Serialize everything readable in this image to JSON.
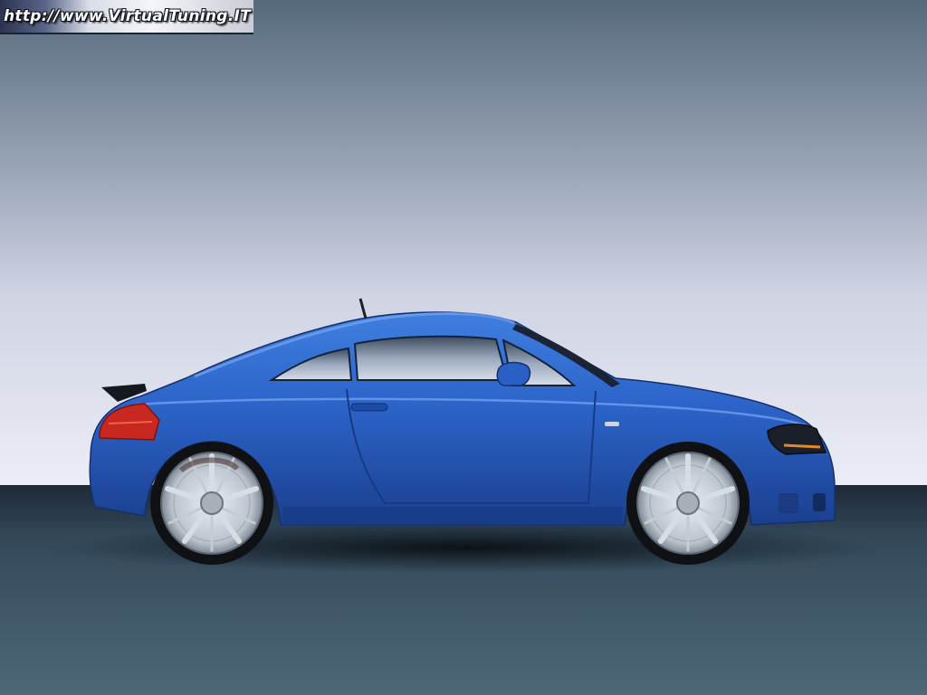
{
  "watermark": {
    "text": "http://www.VirtualTuning.IT"
  },
  "scene": {
    "subject": "car",
    "car_color": "#2f62c4",
    "sky_top": "#55687a",
    "sky_bottom": "#e8eaf4",
    "ground_color": "#2c3c4a"
  }
}
